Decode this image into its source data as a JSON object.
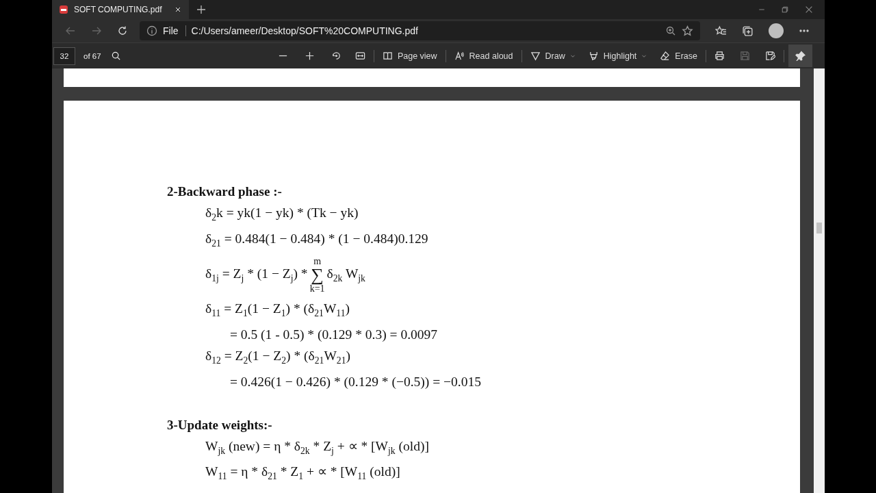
{
  "tab": {
    "title": "SOFT COMPUTING.pdf",
    "selected": true
  },
  "address_bar": {
    "scheme": "File",
    "url": "C:/Users/ameer/Desktop/SOFT%20COMPUTING.pdf"
  },
  "pdf_toolbar": {
    "page_number": "32",
    "page_count": "of 67",
    "page_view": "Page view",
    "read_aloud": "Read aloud",
    "draw": "Draw",
    "highlight": "Highlight",
    "erase": "Erase",
    "save_disabled": true,
    "pin_selected": true
  },
  "document": {
    "sections": [
      {
        "heading": "2-Backward phase :-",
        "lines": [
          {
            "kind": "line",
            "text": "δ$_{2}$k = yk(1 − yk) * (Tk − yk)"
          },
          {
            "kind": "line",
            "text": "δ$_{21}$ = 0.484(1 − 0.484) * (1 − 0.484)0.129"
          },
          {
            "kind": "sum",
            "before": "δ$_{1j}$ = Z$_{j}$ * (1 − Z$_{j}$) *",
            "upper": "m",
            "symbol": "∑",
            "lower": "k=1",
            "after": "δ$_{2k}$ W$_{jk}$"
          },
          {
            "kind": "line",
            "text": "δ$_{11}$ = Z$_{1}$(1 − Z$_{1}$) * (δ$_{21}$W$_{11}$)"
          },
          {
            "kind": "continued",
            "text": "= 0.5 (1 - 0.5) * (0.129 * 0.3) = 0.0097"
          },
          {
            "kind": "line",
            "text": "δ$_{12}$ = Z$_{2}$(1 − Z$_{2}$) * (δ$_{21}$W$_{21}$)"
          },
          {
            "kind": "continued",
            "text": "= 0.426(1 − 0.426) * (0.129 * (−0.5)) = −0.015"
          }
        ]
      },
      {
        "heading": "3-Update weights:-",
        "lines": [
          {
            "kind": "line",
            "text": "W$_{jk}$ (new) = η * δ$_{2k}$ * Z$_{j}$ + ∝ * [W$_{jk}$ (old)]"
          },
          {
            "kind": "line",
            "text": "W$_{11}$ = η * δ$_{21}$ * Z$_{1}$ + ∝ * [W$_{11}$ (old)]"
          }
        ]
      }
    ]
  }
}
